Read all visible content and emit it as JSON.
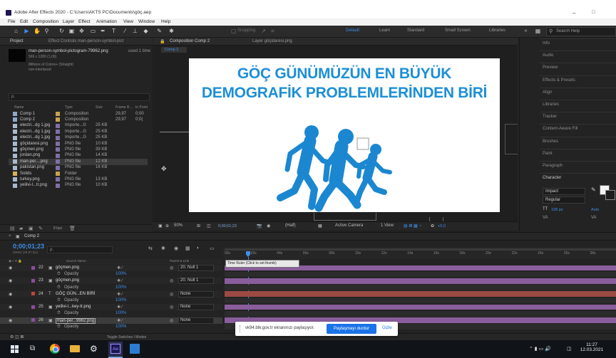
{
  "window": {
    "title": "Adobe After Effects 2020 - C:\\Users\\AKTS PC\\Documents\\göç.aep",
    "minimize_glyph": "–",
    "maximize_glyph": "□"
  },
  "menu": [
    "File",
    "Edit",
    "Composition",
    "Layer",
    "Effect",
    "Animation",
    "View",
    "Window",
    "Help"
  ],
  "toolbar": {
    "snapping": "Snapping",
    "workspaces": [
      "Default",
      "Learn",
      "Standard",
      "Small Screen",
      "Libraries"
    ],
    "active_workspace": "Default",
    "search_placeholder": "Search Help"
  },
  "project_panel": {
    "tab_project": "Project",
    "tab_effects": "Effect Controls man-person-symbol-pict",
    "selected_name": "man-person-symbol-pictogram-79962.png",
    "used": "used 1 time",
    "dims": "569 x 1280 (1,00)",
    "colors": "Millions of Colors+ (Straight)",
    "interlace": "non-interlaced",
    "search_placeholder": "ρ.",
    "columns": [
      "Name",
      "Type",
      "Size",
      "Frame R...",
      "In Point"
    ],
    "items": [
      {
        "name": "Comp 1",
        "type": "Composition",
        "size": "",
        "fps": "29,97",
        "inpoint": "0;00",
        "kind": "comp",
        "label": "#c8a24e"
      },
      {
        "name": "Comp 2",
        "type": "Composition",
        "size": "",
        "fps": "29,97",
        "inpoint": "0;0(",
        "kind": "comp",
        "label": "#c8a24e"
      },
      {
        "name": "electri...dg 1.jpg",
        "type": "Importe...G",
        "size": "25 KB",
        "fps": "",
        "inpoint": "",
        "kind": "file",
        "label": "#7f6fa6"
      },
      {
        "name": "electri...dg 1.jpg",
        "type": "Importe...G",
        "size": "25 KB",
        "fps": "",
        "inpoint": "",
        "kind": "file",
        "label": "#7f6fa6"
      },
      {
        "name": "electri...dg 1.jpg",
        "type": "Importe...G",
        "size": "25 KB",
        "fps": "",
        "inpoint": "",
        "kind": "file",
        "label": "#7f6fa6"
      },
      {
        "name": "göçidaresi.png",
        "type": "PNG file",
        "size": "10 KB",
        "fps": "",
        "inpoint": "",
        "kind": "file",
        "label": "#7f6fa6"
      },
      {
        "name": "göçmen.png",
        "type": "PNG file",
        "size": "39 KB",
        "fps": "",
        "inpoint": "",
        "kind": "file",
        "label": "#7f6fa6"
      },
      {
        "name": "jordan.png",
        "type": "PNG file",
        "size": "14 KB",
        "fps": "",
        "inpoint": "",
        "kind": "file",
        "label": "#7f6fa6"
      },
      {
        "name": "man-per....png",
        "type": "PNG file",
        "size": "12 KB",
        "fps": "",
        "inpoint": "",
        "kind": "file",
        "label": "#7f6fa6",
        "selected": true
      },
      {
        "name": "pakistan.png",
        "type": "PNG file",
        "size": "16 KB",
        "fps": "",
        "inpoint": "",
        "kind": "file",
        "label": "#7f6fa6"
      },
      {
        "name": "Solids",
        "type": "Folder",
        "size": "",
        "fps": "",
        "inpoint": "",
        "kind": "folder",
        "label": "#c8a24e"
      },
      {
        "name": "turkey.png",
        "type": "PNG file",
        "size": "13 KB",
        "fps": "",
        "inpoint": "",
        "kind": "file",
        "label": "#7f6fa6"
      },
      {
        "name": "yeilivi-l...tr.png",
        "type": "PNG file",
        "size": "10 KB",
        "fps": "",
        "inpoint": "",
        "kind": "file",
        "label": "#7f6fa6"
      }
    ],
    "bpc": "8 bpc"
  },
  "composition_panel": {
    "tab_comp": "Composition Comp 2",
    "tab_layer": "Layer göçidaresi.png",
    "sub_tab": "Comp 2",
    "headline": "GÖÇ GÜNÜMÜZÜN EN BÜYÜK DEMOGRAFİK PROBLEMLERİNDEN BİRİ",
    "figure_color": "#1b87d0",
    "zoom": "50%",
    "timecode": "0;00;01;23",
    "resolution": "(Half)",
    "camera": "Active Camera",
    "view": "1 View",
    "exposure": "+0,0"
  },
  "right_panels": {
    "items": [
      "Info",
      "Audio",
      "Preview",
      "Effects & Presets",
      "Align",
      "Libraries",
      "Tracker",
      "Content-Aware Fill",
      "Brushes",
      "Paint",
      "Paragraph",
      "Character"
    ],
    "character_font": "Impact",
    "character_style": "Regular",
    "font_size": "108 px",
    "leading": "Auto"
  },
  "timeline": {
    "tab": "Comp 2",
    "timecode": "0;00;01;23",
    "timecode_sub": "00053 (29.97 fps)",
    "search_placeholder": "ρ.",
    "col_source": "Source Name",
    "col_parent": "Parent & Link",
    "ruler_labels": [
      "00s",
      "02s",
      "04s",
      "06s",
      "08s",
      "10s",
      "12s",
      "14s",
      "16s",
      "18s",
      "20s",
      "22s",
      "24s",
      "26s",
      "28s"
    ],
    "tooltip": "Time Ruler (Click to set thumb)",
    "layers": [
      {
        "num": "22",
        "name": "göçmen.png",
        "parent": "20. Null 1",
        "color": "#8b4da0",
        "track": "#8a5d9c"
      },
      {
        "num": "23",
        "name": "göçmen.png",
        "parent": "20. Null 1",
        "color": "#8b4da0",
        "track": "#8a5d9c"
      },
      {
        "num": "24",
        "name": "GÖÇ GÜN...EN BİRİ",
        "parent": "None",
        "color": "#c0443c",
        "track": "#9c4a44",
        "text": true
      },
      {
        "num": "25",
        "name": "yeilivi-l...key-tr.png",
        "parent": "None",
        "color": "#8b4da0",
        "track": "#8a5d9c"
      },
      {
        "num": "26",
        "name": "man-per...9962.png",
        "parent": "None",
        "color": "#8b4da0",
        "track": "#8a5d9c",
        "selected": true
      }
    ],
    "opacity_label": "Opacity",
    "opacity_value": "100%",
    "toggle": "Toggle Switches / Modes"
  },
  "share_bar": {
    "text": "vk94.btk.gov.tr ekranınızı paylaşıyor.",
    "stop": "Paylaşmayı durdur",
    "hide": "Gizle"
  },
  "taskbar": {
    "time": "11:27",
    "date": "12.03.2021"
  }
}
